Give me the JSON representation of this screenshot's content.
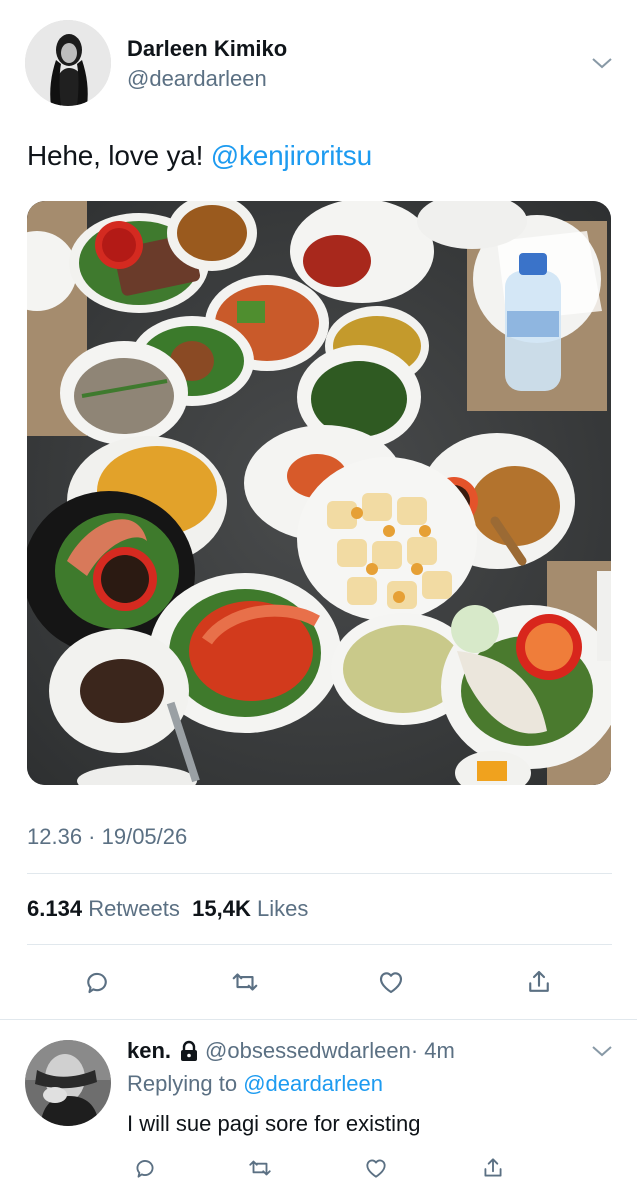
{
  "tweet": {
    "author_name": "Darleen Kimiko",
    "author_handle": "@deardarleen",
    "text": "Hehe, love ya! ",
    "mention": "@kenjiroritsu",
    "timestamp": "12.36 · 19/05/26",
    "retweet_count": "6.134",
    "retweet_label": "Retweets",
    "like_count": "15,4K",
    "like_label": "Likes",
    "image_description_icon": "photo-of-food-platters"
  },
  "actions": [
    "reply-icon",
    "retweet-icon",
    "like-icon",
    "share-icon"
  ],
  "reply": {
    "author_name": "ken.",
    "author_handle": "@obsessedwdarleen",
    "time": "· 4m",
    "replying_prefix": "Replying to",
    "replying_to": "@deardarleen",
    "text": "I will sue pagi sore for existing"
  },
  "colors": {
    "accent": "#1d9bf0",
    "secondary_text": "#5b7083",
    "divider": "#e1e8ed"
  }
}
